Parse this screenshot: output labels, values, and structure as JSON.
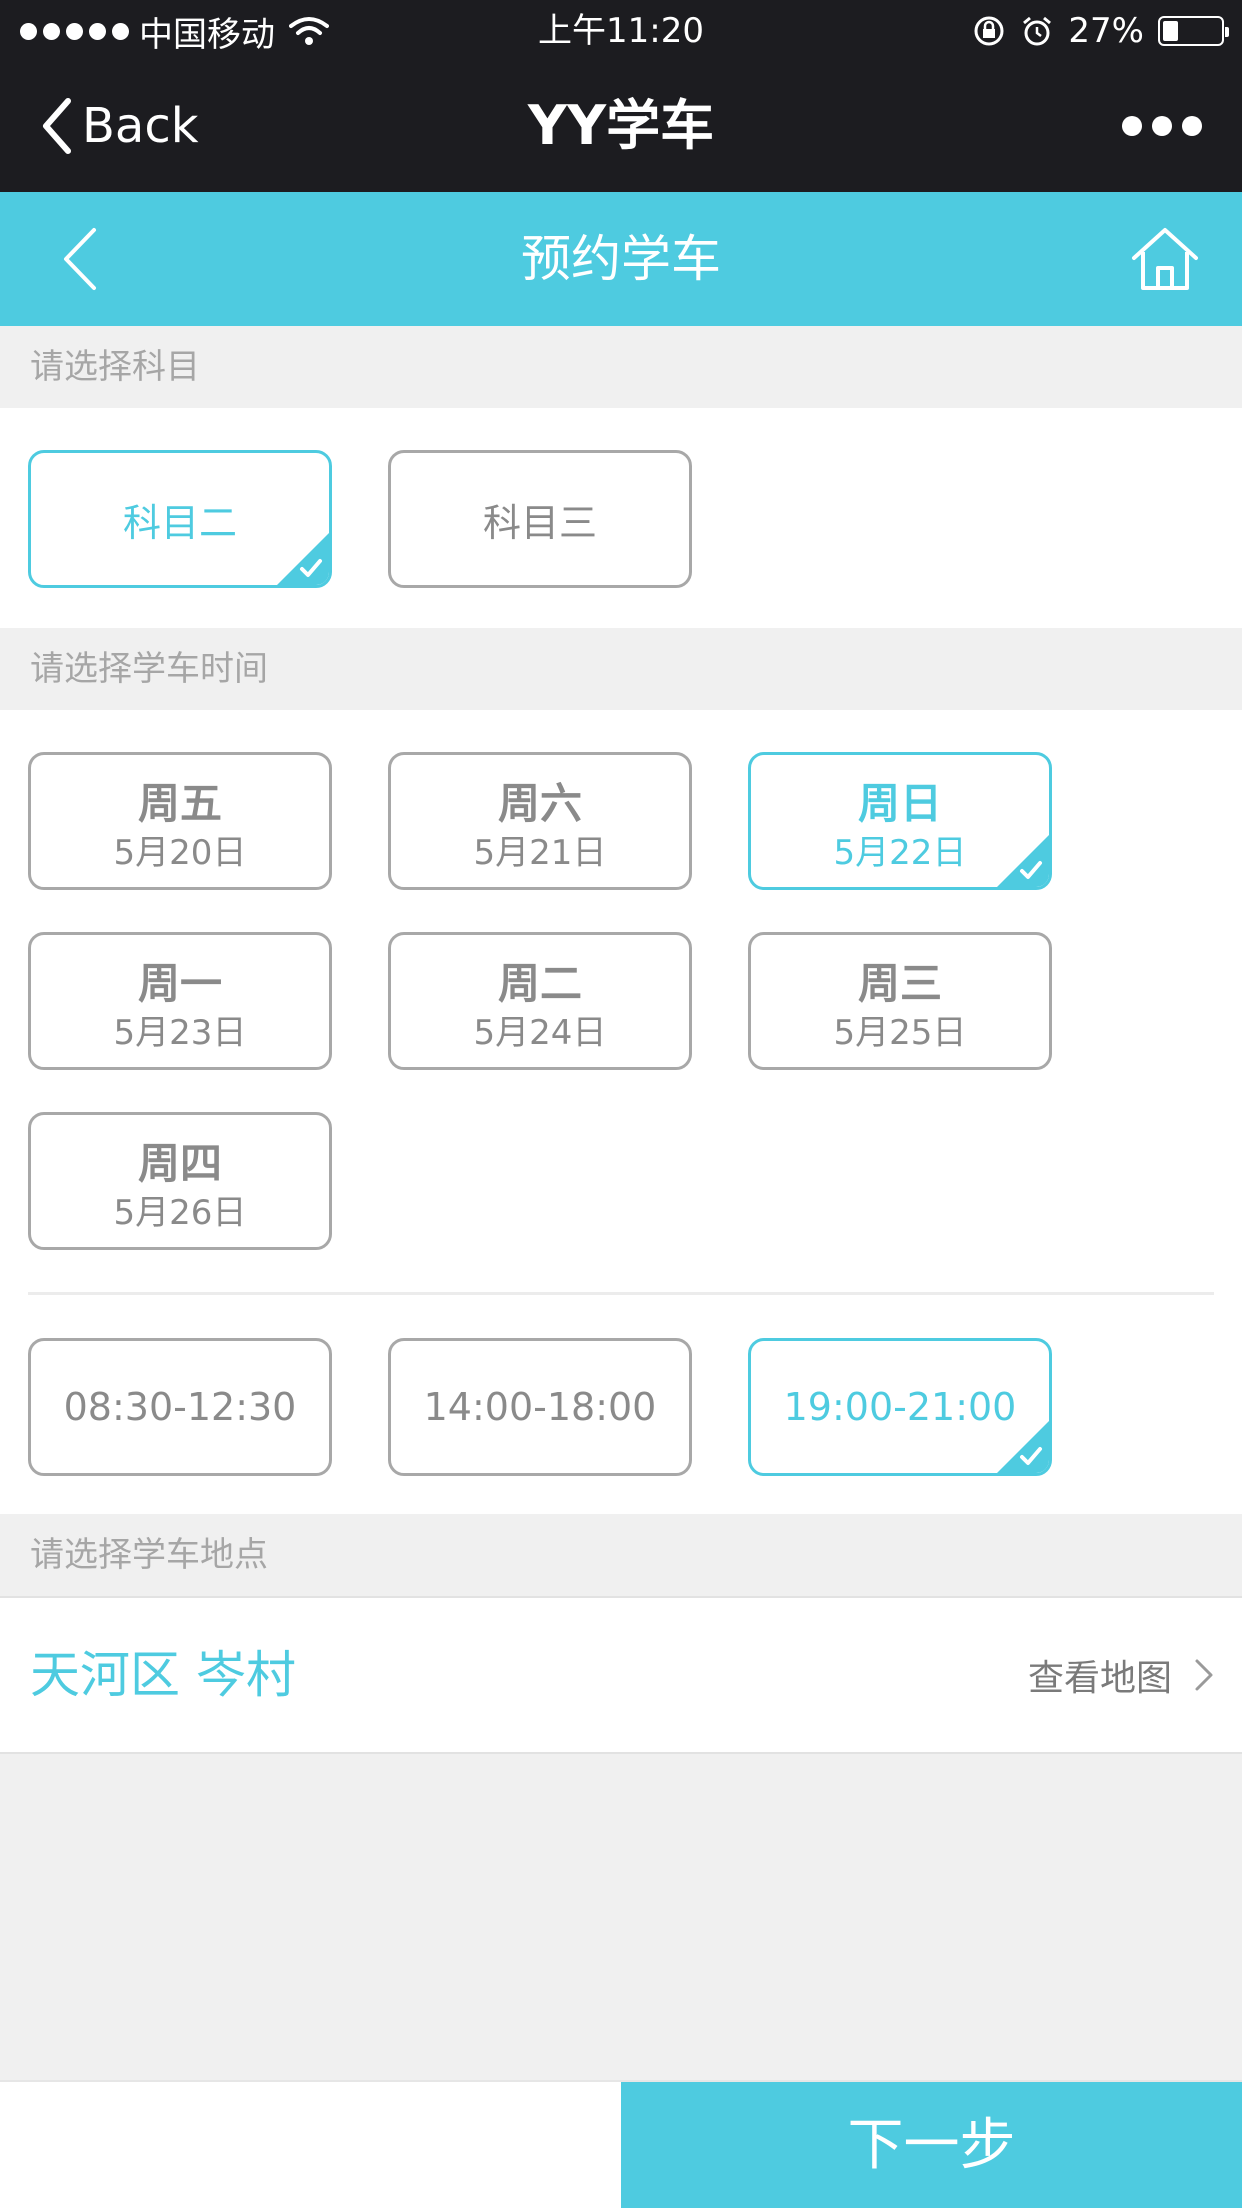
{
  "status_bar": {
    "carrier": "中国移动",
    "time": "上午11:20",
    "battery_text": "27%",
    "battery_level": 0.27
  },
  "nav_bar": {
    "back_label": "Back",
    "title": "YY学车"
  },
  "header": {
    "title": "预约学车"
  },
  "subject_section": {
    "label": "请选择科目",
    "options": [
      {
        "label": "科目二",
        "selected": true
      },
      {
        "label": "科目三",
        "selected": false
      }
    ]
  },
  "time_section": {
    "label": "请选择学车时间",
    "days": [
      {
        "day": "周五",
        "date": "5月20日",
        "selected": false
      },
      {
        "day": "周六",
        "date": "5月21日",
        "selected": false
      },
      {
        "day": "周日",
        "date": "5月22日",
        "selected": true
      },
      {
        "day": "周一",
        "date": "5月23日",
        "selected": false
      },
      {
        "day": "周二",
        "date": "5月24日",
        "selected": false
      },
      {
        "day": "周三",
        "date": "5月25日",
        "selected": false
      },
      {
        "day": "周四",
        "date": "5月26日",
        "selected": false
      }
    ],
    "slots": [
      {
        "label": "08:30-12:30",
        "selected": false
      },
      {
        "label": "14:00-18:00",
        "selected": false
      },
      {
        "label": "19:00-21:00",
        "selected": true
      }
    ]
  },
  "location_section": {
    "label": "请选择学车地点",
    "location": "天河区 岑村",
    "map_link": "查看地图"
  },
  "footer": {
    "next_label": "下一步"
  },
  "colors": {
    "accent": "#4ecbe0",
    "nav_bg": "#1c1c20",
    "unselected_border": "#a8a8a8",
    "background": "#f0f0f0"
  }
}
